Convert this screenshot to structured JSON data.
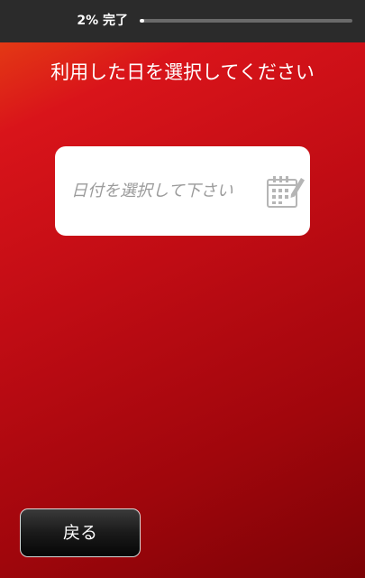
{
  "progress": {
    "label": "2% 完了",
    "fraction": 0.02
  },
  "question": {
    "title": "利用した日を選択してください"
  },
  "date_field": {
    "placeholder": "日付を選択して下さい",
    "icon": "calendar-edit-icon"
  },
  "navigation": {
    "back_label": "戻る"
  },
  "colors": {
    "background_top": "#e84a12",
    "background_bottom": "#7c0306",
    "header_bar": "#2b2b2b",
    "field_background": "#ffffff",
    "placeholder_text": "#9b9b9b",
    "button_background": "#1a1a1a"
  }
}
